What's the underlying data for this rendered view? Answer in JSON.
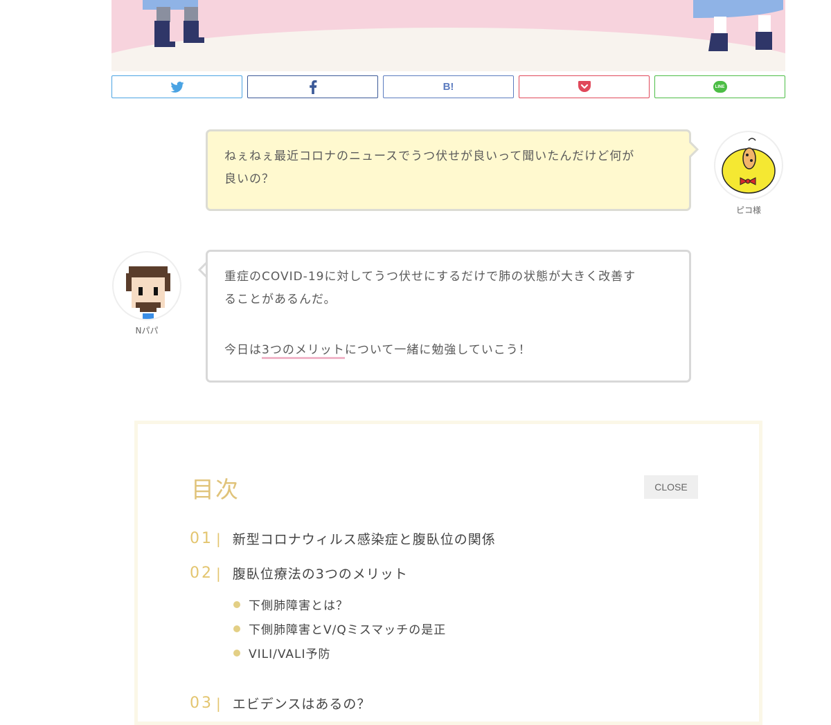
{
  "share": {
    "buttons": [
      {
        "name": "twitter",
        "color": "#4aa3e3",
        "icon": "twitter-icon"
      },
      {
        "name": "facebook",
        "color": "#3b5998",
        "icon": "facebook-icon"
      },
      {
        "name": "hatena",
        "color": "#5b7bbf",
        "icon": "hatena-bookmark-icon",
        "label": "B!"
      },
      {
        "name": "pocket",
        "color": "#e0485a",
        "icon": "pocket-icon"
      },
      {
        "name": "line",
        "color": "#4cbd45",
        "icon": "line-icon",
        "label": "LINE"
      }
    ]
  },
  "dialog": {
    "piko": {
      "name": "ピコ様",
      "line1": "ねぇねぇ最近コロナのニュースでうつ伏せが良いって聞いたんだけど何が",
      "line2": "良いの？"
    },
    "npapa": {
      "name": "Nパパ",
      "line1": "重症のCOVID-19に対してうつ伏せにするだけで肺の状態が大きく改善す",
      "line2": "ることがあるんだ。",
      "line3_pre": "今日は",
      "line3_em": "3つのメリット",
      "line3_post": "について一緒に勉強していこう！"
    }
  },
  "toc": {
    "title": "目次",
    "close_label": "CLOSE",
    "items": [
      {
        "num": "01",
        "label": "新型コロナウィルス感染症と腹臥位の関係"
      },
      {
        "num": "02",
        "label": "腹臥位療法の3つのメリット",
        "children": [
          "下側肺障害とは？",
          "下側肺障害とV/Qミスマッチの是正",
          "VILI/VALI予防"
        ]
      },
      {
        "num": "03",
        "label": "エビデンスはあるの？"
      }
    ]
  },
  "colors": {
    "accent": "#e3c56f",
    "bubble_yellow": "#fff9cf",
    "hero_pink": "#f7d3dd"
  }
}
